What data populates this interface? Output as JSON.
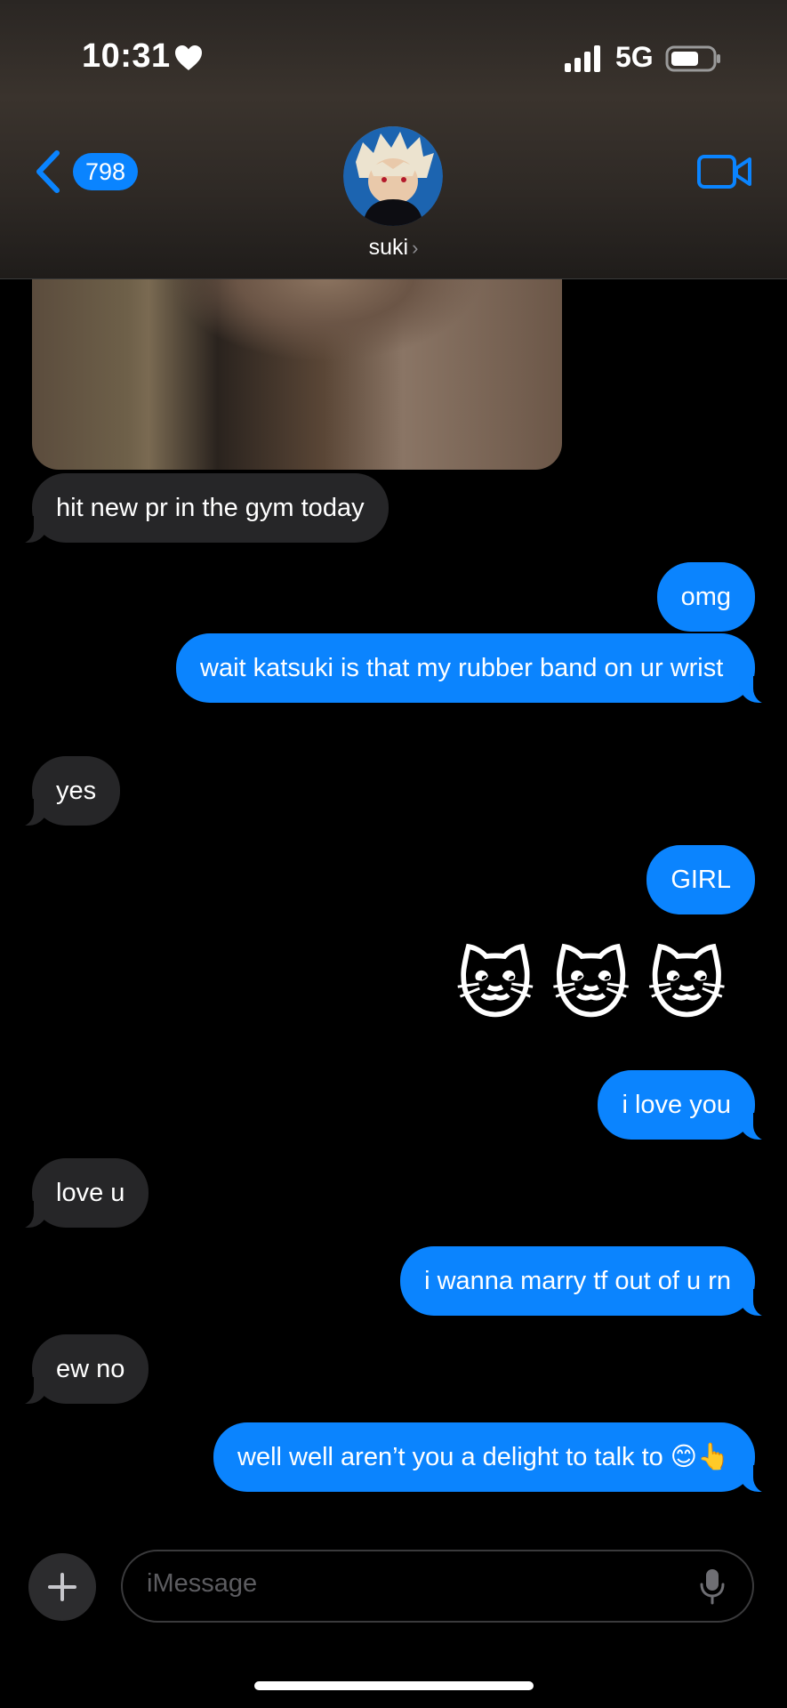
{
  "status_bar": {
    "time": "10:31",
    "network": "5G"
  },
  "header": {
    "unread_count": "798",
    "contact_name": "suki",
    "contact_chevron": "›"
  },
  "messages": [
    {
      "side": "in",
      "text": "hit new pr in the gym today"
    },
    {
      "side": "out",
      "text": "omg"
    },
    {
      "side": "out",
      "text": "wait katsuki is that my rubber band on ur wrist"
    },
    {
      "side": "in",
      "text": "yes"
    },
    {
      "side": "out",
      "text": "GIRL"
    },
    {
      "side": "out",
      "text": "🐱🐱🐱",
      "type": "emoji"
    },
    {
      "side": "out",
      "text": "i love you"
    },
    {
      "side": "in",
      "text": "love u"
    },
    {
      "side": "out",
      "text": "i wanna marry tf out of u rn"
    },
    {
      "side": "in",
      "text": "ew no"
    },
    {
      "side": "out",
      "text": "well well aren’t you a delight to talk to 😊👆"
    }
  ],
  "composer": {
    "placeholder": "iMessage"
  },
  "colors": {
    "accent": "#0a84ff",
    "incoming_bubble": "#262628",
    "background": "#000000"
  },
  "icons": [
    "heart-icon",
    "signal-icon",
    "battery-icon",
    "back-chevron-icon",
    "video-call-icon",
    "plus-icon",
    "microphone-icon"
  ]
}
